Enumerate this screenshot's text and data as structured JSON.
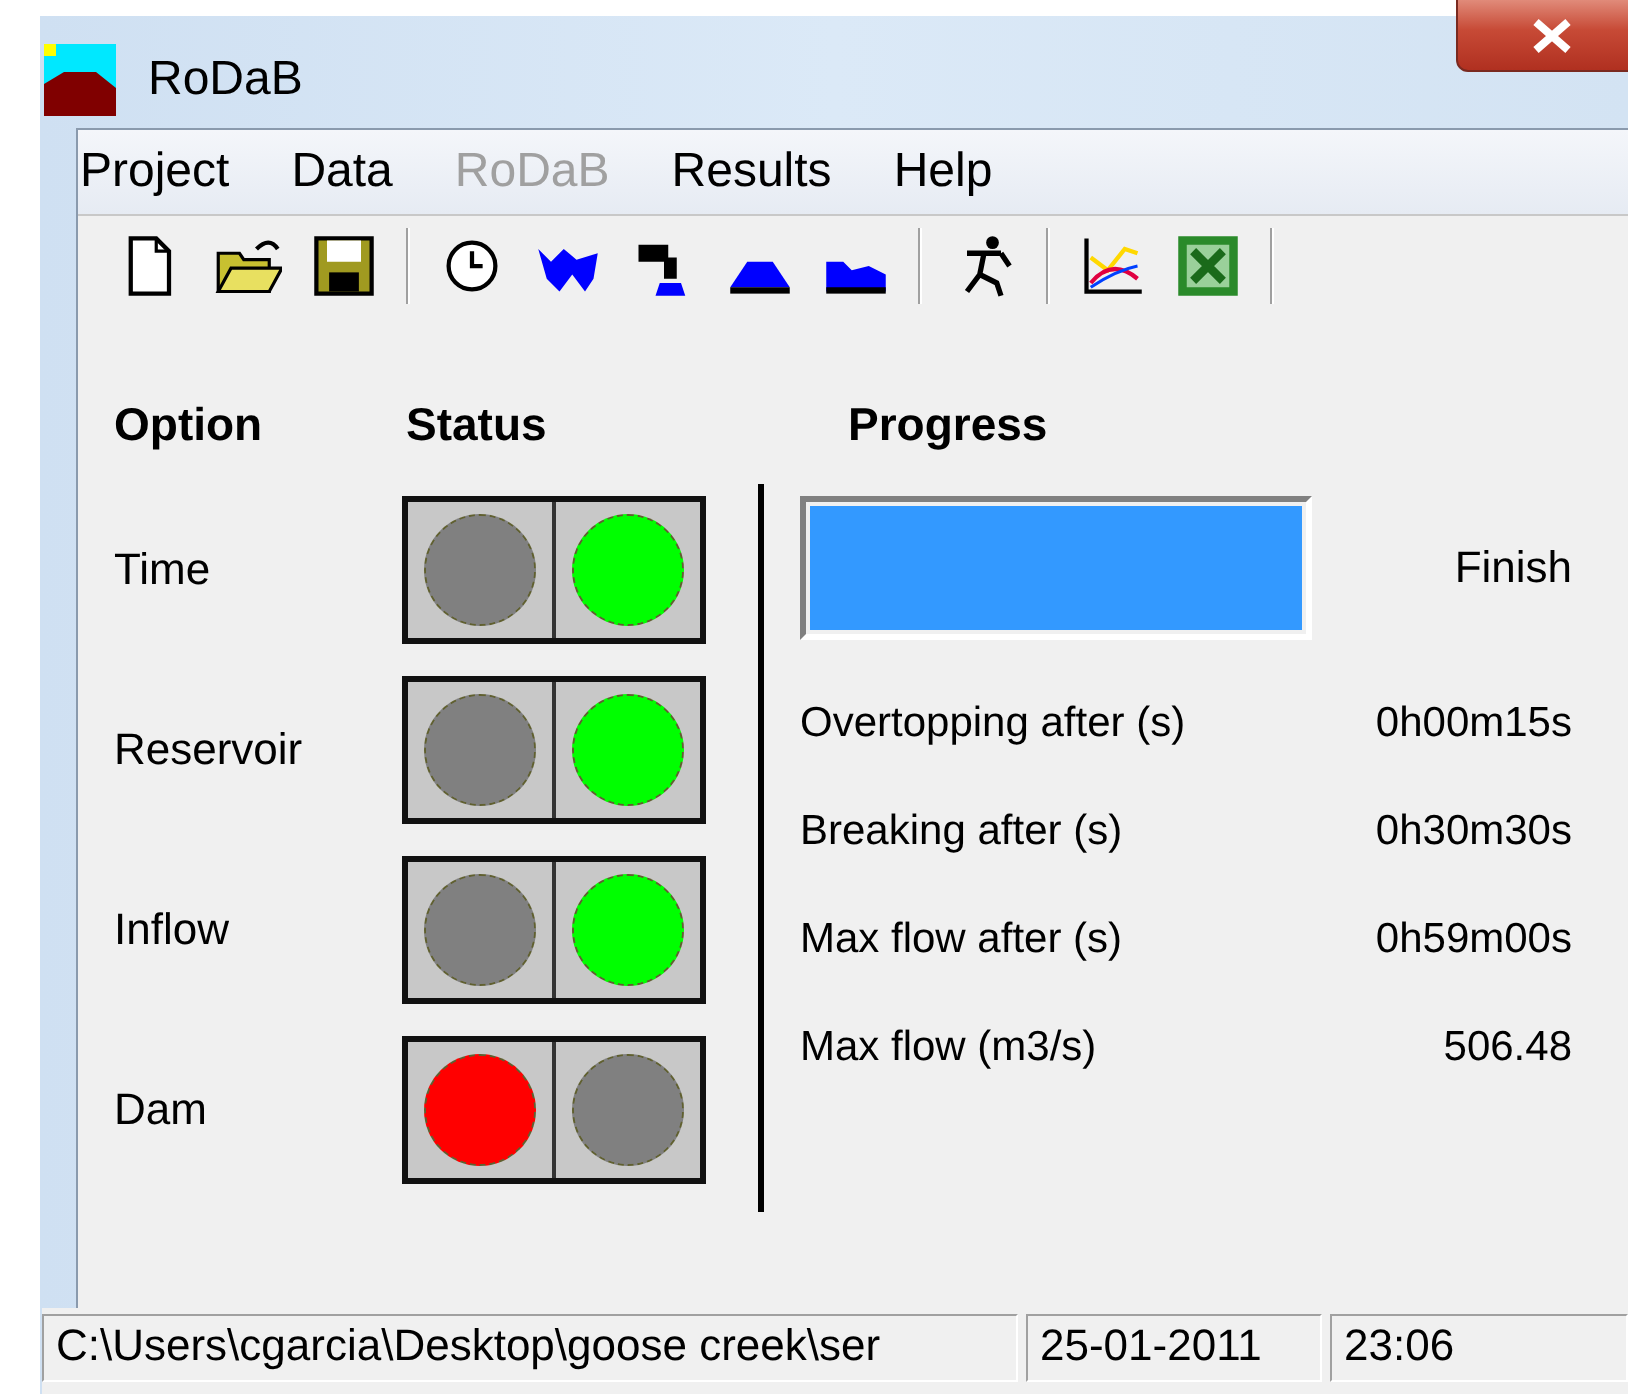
{
  "window": {
    "title": "RoDaB"
  },
  "menu": [
    {
      "label": "Project",
      "disabled": false
    },
    {
      "label": "Data",
      "disabled": false
    },
    {
      "label": "RoDaB",
      "disabled": true
    },
    {
      "label": "Results",
      "disabled": false
    },
    {
      "label": "Help",
      "disabled": false
    }
  ],
  "headers": {
    "option": "Option",
    "status": "Status",
    "progress": "Progress"
  },
  "options": [
    {
      "name": "Time",
      "lamps": [
        {
          "color": "#808080"
        },
        {
          "color": "#00ff00"
        }
      ]
    },
    {
      "name": "Reservoir",
      "lamps": [
        {
          "color": "#808080"
        },
        {
          "color": "#00ff00"
        }
      ]
    },
    {
      "name": "Inflow",
      "lamps": [
        {
          "color": "#808080"
        },
        {
          "color": "#00ff00"
        }
      ]
    },
    {
      "name": "Dam",
      "lamps": [
        {
          "color": "#ff0000"
        },
        {
          "color": "#808080"
        }
      ]
    }
  ],
  "progress": {
    "level": 1,
    "label": "Finish"
  },
  "results": [
    {
      "label": "Overtopping after (s)",
      "value": "0h00m15s"
    },
    {
      "label": "Breaking after (s)",
      "value": "0h30m30s"
    },
    {
      "label": "Max flow after (s)",
      "value": "0h59m00s"
    },
    {
      "label": "Max flow (m3/s)",
      "value": "506.48"
    }
  ],
  "status_bar": {
    "path": "C:\\Users\\cgarcia\\Desktop\\goose creek\\ser",
    "date": "25-01-2011",
    "time": "23:06"
  }
}
